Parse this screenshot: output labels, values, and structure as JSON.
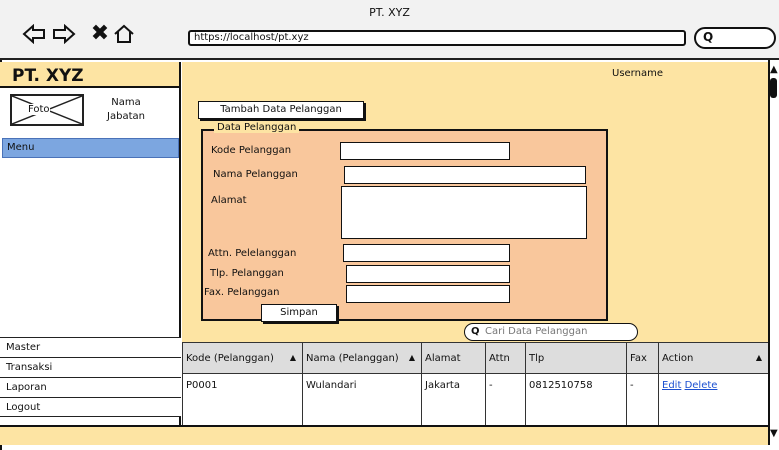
{
  "window": {
    "title": "PT. XYZ"
  },
  "browser": {
    "back_icon": "arrow-left-icon",
    "forward_icon": "arrow-right-icon",
    "close_glyph": "✖",
    "home_icon": "home-icon",
    "url": "https://localhost/pt.xyz",
    "search_glyph": "Q"
  },
  "app": {
    "title": "PT. XYZ",
    "username": "Username"
  },
  "profile": {
    "photo_label": "Foto",
    "name": "Nama",
    "role": "Jabatan"
  },
  "sidebar": {
    "menu_header": "Menu",
    "items": [
      {
        "label": "Master"
      },
      {
        "label": "Transaksi"
      },
      {
        "label": "Laporan"
      },
      {
        "label": "Logout"
      }
    ]
  },
  "form": {
    "add_button": "Tambah Data Pelanggan",
    "legend": "Data Pelanggan",
    "fields": {
      "kode": {
        "label": "Kode Pelanggan",
        "value": ""
      },
      "nama": {
        "label": "Nama Pelanggan",
        "value": ""
      },
      "alamat": {
        "label": "Alamat",
        "value": ""
      },
      "attn": {
        "label": "Attn. Pelelanggan",
        "value": ""
      },
      "tlp": {
        "label": "Tlp. Pelanggan",
        "value": ""
      },
      "fax": {
        "label": "Fax. Pelanggan",
        "value": ""
      }
    },
    "save_button": "Simpan"
  },
  "search": {
    "glyph": "Q",
    "placeholder": "Cari Data Pelanggan"
  },
  "table": {
    "columns": [
      "Kode (Pelanggan)",
      "Nama (Pelanggan)",
      "Alamat",
      "Attn",
      "Tlp",
      "Fax",
      "Action"
    ],
    "sort_glyph": "▲",
    "rows": [
      {
        "kode": "P0001",
        "nama": "Wulandari",
        "alamat": "Jakarta",
        "attn": "-",
        "tlp": "0812510758",
        "fax": "-",
        "edit": "Edit",
        "delete": "Delete"
      }
    ]
  },
  "scrollbar": {
    "up": "▲",
    "down": "▼"
  },
  "colors": {
    "header_bg": "#fde4a3",
    "form_bg": "#f9c79c",
    "menu_active": "#7ca6e0",
    "link": "#1a4fd0"
  }
}
